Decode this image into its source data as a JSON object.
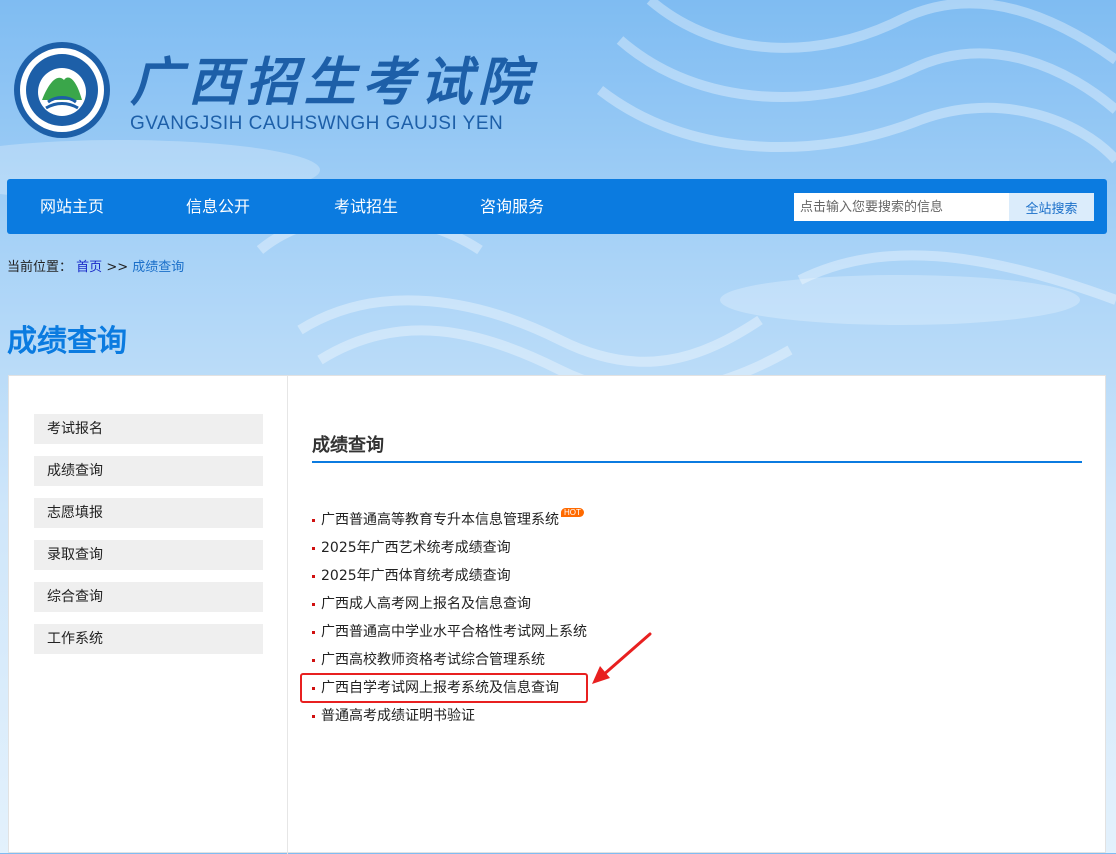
{
  "header": {
    "title": "广西招生考试院",
    "subtitle": "GVANGJSIH CAUHSWNGH GAUJSI YEN",
    "logo_text": "广西招生考试院 GVANGJSIH CAUHSWNGH GAUJSI YEN"
  },
  "nav": {
    "items": [
      {
        "label": "网站主页"
      },
      {
        "label": "信息公开"
      },
      {
        "label": "考试招生"
      },
      {
        "label": "咨询服务"
      }
    ],
    "search": {
      "placeholder": "点击输入您要搜索的信息",
      "button_label": "全站搜索"
    }
  },
  "breadcrumb": {
    "prefix": "当前位置：",
    "home": "首页",
    "separator": ">>",
    "current": "成绩查询"
  },
  "page_title": "成绩查询",
  "sidebar": {
    "items": [
      {
        "label": "考试报名"
      },
      {
        "label": "成绩查询"
      },
      {
        "label": "志愿填报"
      },
      {
        "label": "录取查询"
      },
      {
        "label": "综合查询"
      },
      {
        "label": "工作系统"
      }
    ]
  },
  "main": {
    "title": "成绩查询",
    "hot_badge": "HOT",
    "links": [
      {
        "label": "广西普通高等教育专升本信息管理系统"
      },
      {
        "label": "2025年广西艺术统考成绩查询"
      },
      {
        "label": "2025年广西体育统考成绩查询"
      },
      {
        "label": "广西成人高考网上报名及信息查询"
      },
      {
        "label": "广西普通高中学业水平合格性考试网上系统"
      },
      {
        "label": "广西高校教师资格考试综合管理系统"
      },
      {
        "label": "广西自学考试网上报考系统及信息查询"
      },
      {
        "label": "普通高考成绩证明书验证"
      }
    ]
  },
  "colors": {
    "nav_bg": "#0b7be0",
    "title_blue": "#0b7be0",
    "bullet_red": "#d01010",
    "annotation_red": "#e82020",
    "hot_orange": "#ff6a00"
  }
}
